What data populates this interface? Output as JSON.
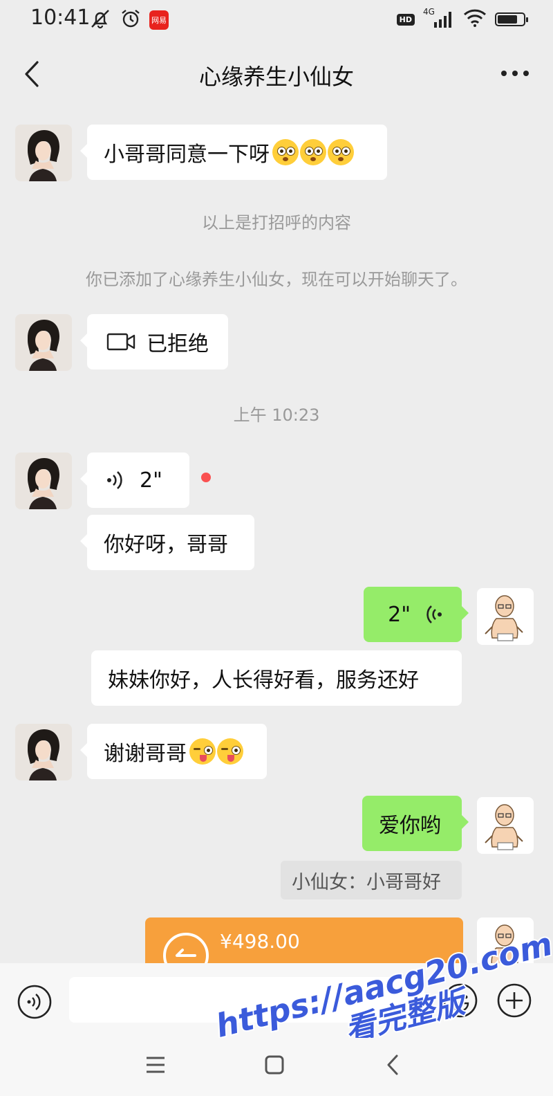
{
  "status_bar": {
    "time": "10:41",
    "app_badge": "网易",
    "network": "4G",
    "hd": "HD"
  },
  "header": {
    "title": "心缘养生小仙女"
  },
  "messages": {
    "m1": {
      "text": "小哥哥同意一下呀"
    },
    "sys1": "以上是打招呼的内容",
    "sys2": "你已添加了心缘养生小仙女，现在可以开始聊天了。",
    "m2": {
      "text": "已拒绝"
    },
    "time1": "上午 10:23",
    "m3": {
      "duration": "2\""
    },
    "m4": {
      "text": "你好呀，哥哥"
    },
    "m5": {
      "duration": "2\""
    },
    "m6": {
      "text": "妹妹你好，人长得好看，服务还好"
    },
    "m7": {
      "text": "谢谢哥哥"
    },
    "m8": {
      "text": "爱你哟"
    },
    "quote1": "小仙女：小哥哥好",
    "transfer": {
      "amount": "¥498.00"
    }
  },
  "input": {
    "placeholder": ""
  },
  "watermark": {
    "line1": "https://aacg20.com",
    "line2": "看完整版"
  },
  "colors": {
    "bg": "#ededed",
    "green_bubble": "#95ec69",
    "transfer": "#f7a03c",
    "unread": "#fa5151"
  }
}
